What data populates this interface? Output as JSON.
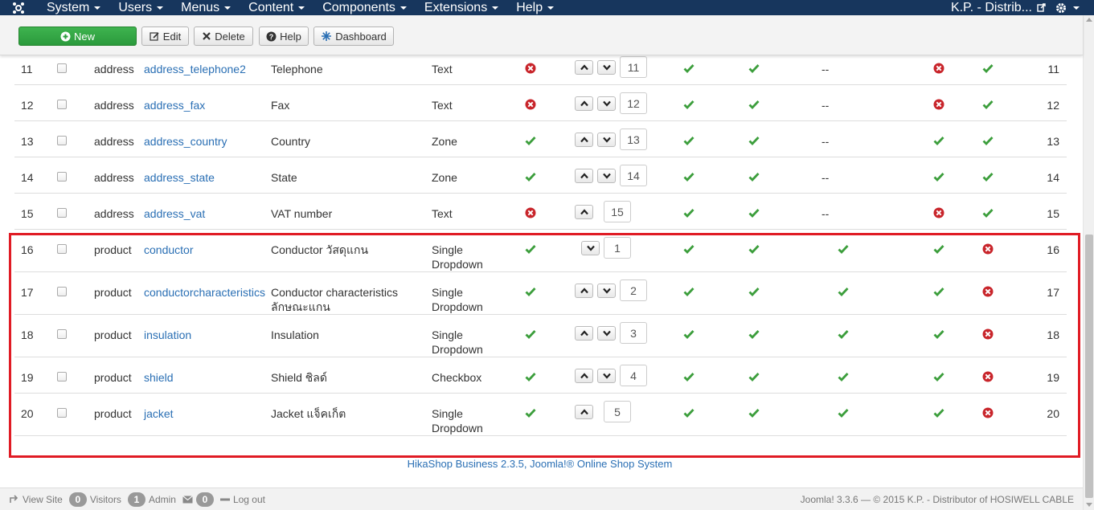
{
  "navbar": {
    "menus": [
      "System",
      "Users",
      "Menus",
      "Content",
      "Components",
      "Extensions",
      "Help"
    ],
    "site_name": "K.P. - Distrib..."
  },
  "toolbar": {
    "new_label": "New",
    "edit_label": "Edit",
    "delete_label": "Delete",
    "help_label": "Help",
    "dashboard_label": "Dashboard"
  },
  "colors": {
    "check": "#3c9e3c",
    "cross": "#c8242a",
    "link": "#2a6fb4",
    "highlight": "#e01b24"
  },
  "rows": [
    {
      "id": "11",
      "table": "address",
      "column": "address_telephone2",
      "label": "Telephone",
      "label2": "",
      "type": "Text",
      "type2": "",
      "required": "no",
      "up": true,
      "down": true,
      "order": "11",
      "i2": "yes",
      "i3": "yes",
      "i4": "--",
      "i5": "no",
      "i6": "yes",
      "last": "11"
    },
    {
      "id": "12",
      "table": "address",
      "column": "address_fax",
      "label": "Fax",
      "label2": "",
      "type": "Text",
      "type2": "",
      "required": "no",
      "up": true,
      "down": true,
      "order": "12",
      "i2": "yes",
      "i3": "yes",
      "i4": "--",
      "i5": "no",
      "i6": "yes",
      "last": "12"
    },
    {
      "id": "13",
      "table": "address",
      "column": "address_country",
      "label": "Country",
      "label2": "",
      "type": "Zone",
      "type2": "",
      "required": "yes",
      "up": true,
      "down": true,
      "order": "13",
      "i2": "yes",
      "i3": "yes",
      "i4": "--",
      "i5": "yes",
      "i6": "yes",
      "last": "13"
    },
    {
      "id": "14",
      "table": "address",
      "column": "address_state",
      "label": "State",
      "label2": "",
      "type": "Zone",
      "type2": "",
      "required": "yes",
      "up": true,
      "down": true,
      "order": "14",
      "i2": "yes",
      "i3": "yes",
      "i4": "--",
      "i5": "yes",
      "i6": "yes",
      "last": "14"
    },
    {
      "id": "15",
      "table": "address",
      "column": "address_vat",
      "label": "VAT number",
      "label2": "",
      "type": "Text",
      "type2": "",
      "required": "no",
      "up": true,
      "down": false,
      "order": "15",
      "i2": "yes",
      "i3": "yes",
      "i4": "--",
      "i5": "no",
      "i6": "yes",
      "last": "15"
    },
    {
      "id": "16",
      "table": "product",
      "column": "conductor",
      "label": "Conductor วัสดุแกน",
      "label2": "",
      "type": "Single",
      "type2": "Dropdown",
      "required": "yes",
      "up": false,
      "down": true,
      "order": "1",
      "i2": "yes",
      "i3": "yes",
      "i4": "yes",
      "i5": "yes",
      "i6": "no",
      "last": "16"
    },
    {
      "id": "17",
      "table": "product",
      "column": "conductorcharacteristics",
      "label": "Conductor characteristics",
      "label2": "ลักษณะแกน",
      "type": "Single",
      "type2": "Dropdown",
      "required": "yes",
      "up": true,
      "down": true,
      "order": "2",
      "i2": "yes",
      "i3": "yes",
      "i4": "yes",
      "i5": "yes",
      "i6": "no",
      "last": "17"
    },
    {
      "id": "18",
      "table": "product",
      "column": "insulation",
      "label": "Insulation",
      "label2": "",
      "type": "Single",
      "type2": "Dropdown",
      "required": "yes",
      "up": true,
      "down": true,
      "order": "3",
      "i2": "yes",
      "i3": "yes",
      "i4": "yes",
      "i5": "yes",
      "i6": "no",
      "last": "18"
    },
    {
      "id": "19",
      "table": "product",
      "column": "shield",
      "label": "Shield ชิลด์",
      "label2": "",
      "type": "Checkbox",
      "type2": "",
      "required": "yes",
      "up": true,
      "down": true,
      "order": "4",
      "i2": "yes",
      "i3": "yes",
      "i4": "yes",
      "i5": "yes",
      "i6": "no",
      "last": "19"
    },
    {
      "id": "20",
      "table": "product",
      "column": "jacket",
      "label": "Jacket แจ็คเก็ต",
      "label2": "",
      "type": "Single",
      "type2": "Dropdown",
      "required": "yes",
      "up": true,
      "down": false,
      "order": "5",
      "i2": "yes",
      "i3": "yes",
      "i4": "yes",
      "i5": "yes",
      "i6": "no",
      "last": "20"
    }
  ],
  "footer": {
    "credit": "HikaShop Business 2.3.5, Joomla!® Online Shop System"
  },
  "statusbar": {
    "view_site": "View Site",
    "visitors_count": "0",
    "visitors_label": "Visitors",
    "admin_count": "1",
    "admin_label": "Admin",
    "messages_count": "0",
    "logout": "Log out",
    "copyright": "Joomla! 3.3.6 — © 2015 K.P. - Distributor of HOSIWELL CABLE"
  }
}
